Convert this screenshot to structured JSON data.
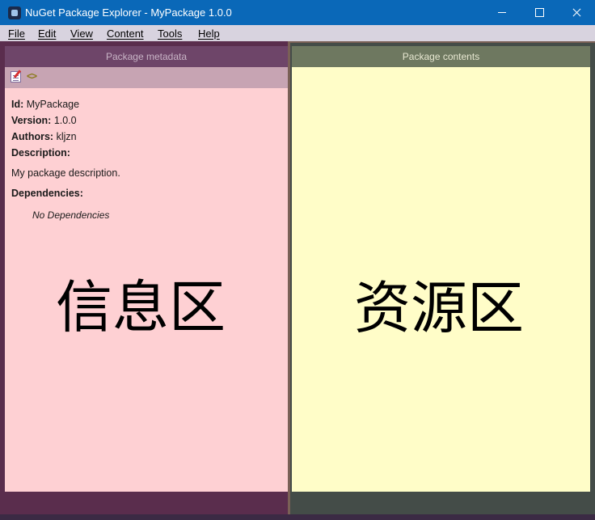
{
  "window": {
    "title": "NuGet Package Explorer - MyPackage 1.0.0"
  },
  "menu": {
    "items": [
      "File",
      "Edit",
      "View",
      "Content",
      "Tools",
      "Help"
    ]
  },
  "metadata_panel": {
    "header": "Package metadata",
    "id_label": "Id:",
    "id_value": "MyPackage",
    "version_label": "Version:",
    "version_value": "1.0.0",
    "authors_label": "Authors:",
    "authors_value": "kljzn",
    "description_label": "Description:",
    "description_value": "My package description.",
    "dependencies_label": "Dependencies:",
    "no_dependencies": "No Dependencies",
    "overlay_label": "信息区"
  },
  "contents_panel": {
    "header": "Package contents",
    "overlay_label": "资源区"
  },
  "colors": {
    "titlebar": "#0a68b8",
    "metadata_bg": "#fed0d3",
    "contents_bg": "#fffdc8"
  }
}
